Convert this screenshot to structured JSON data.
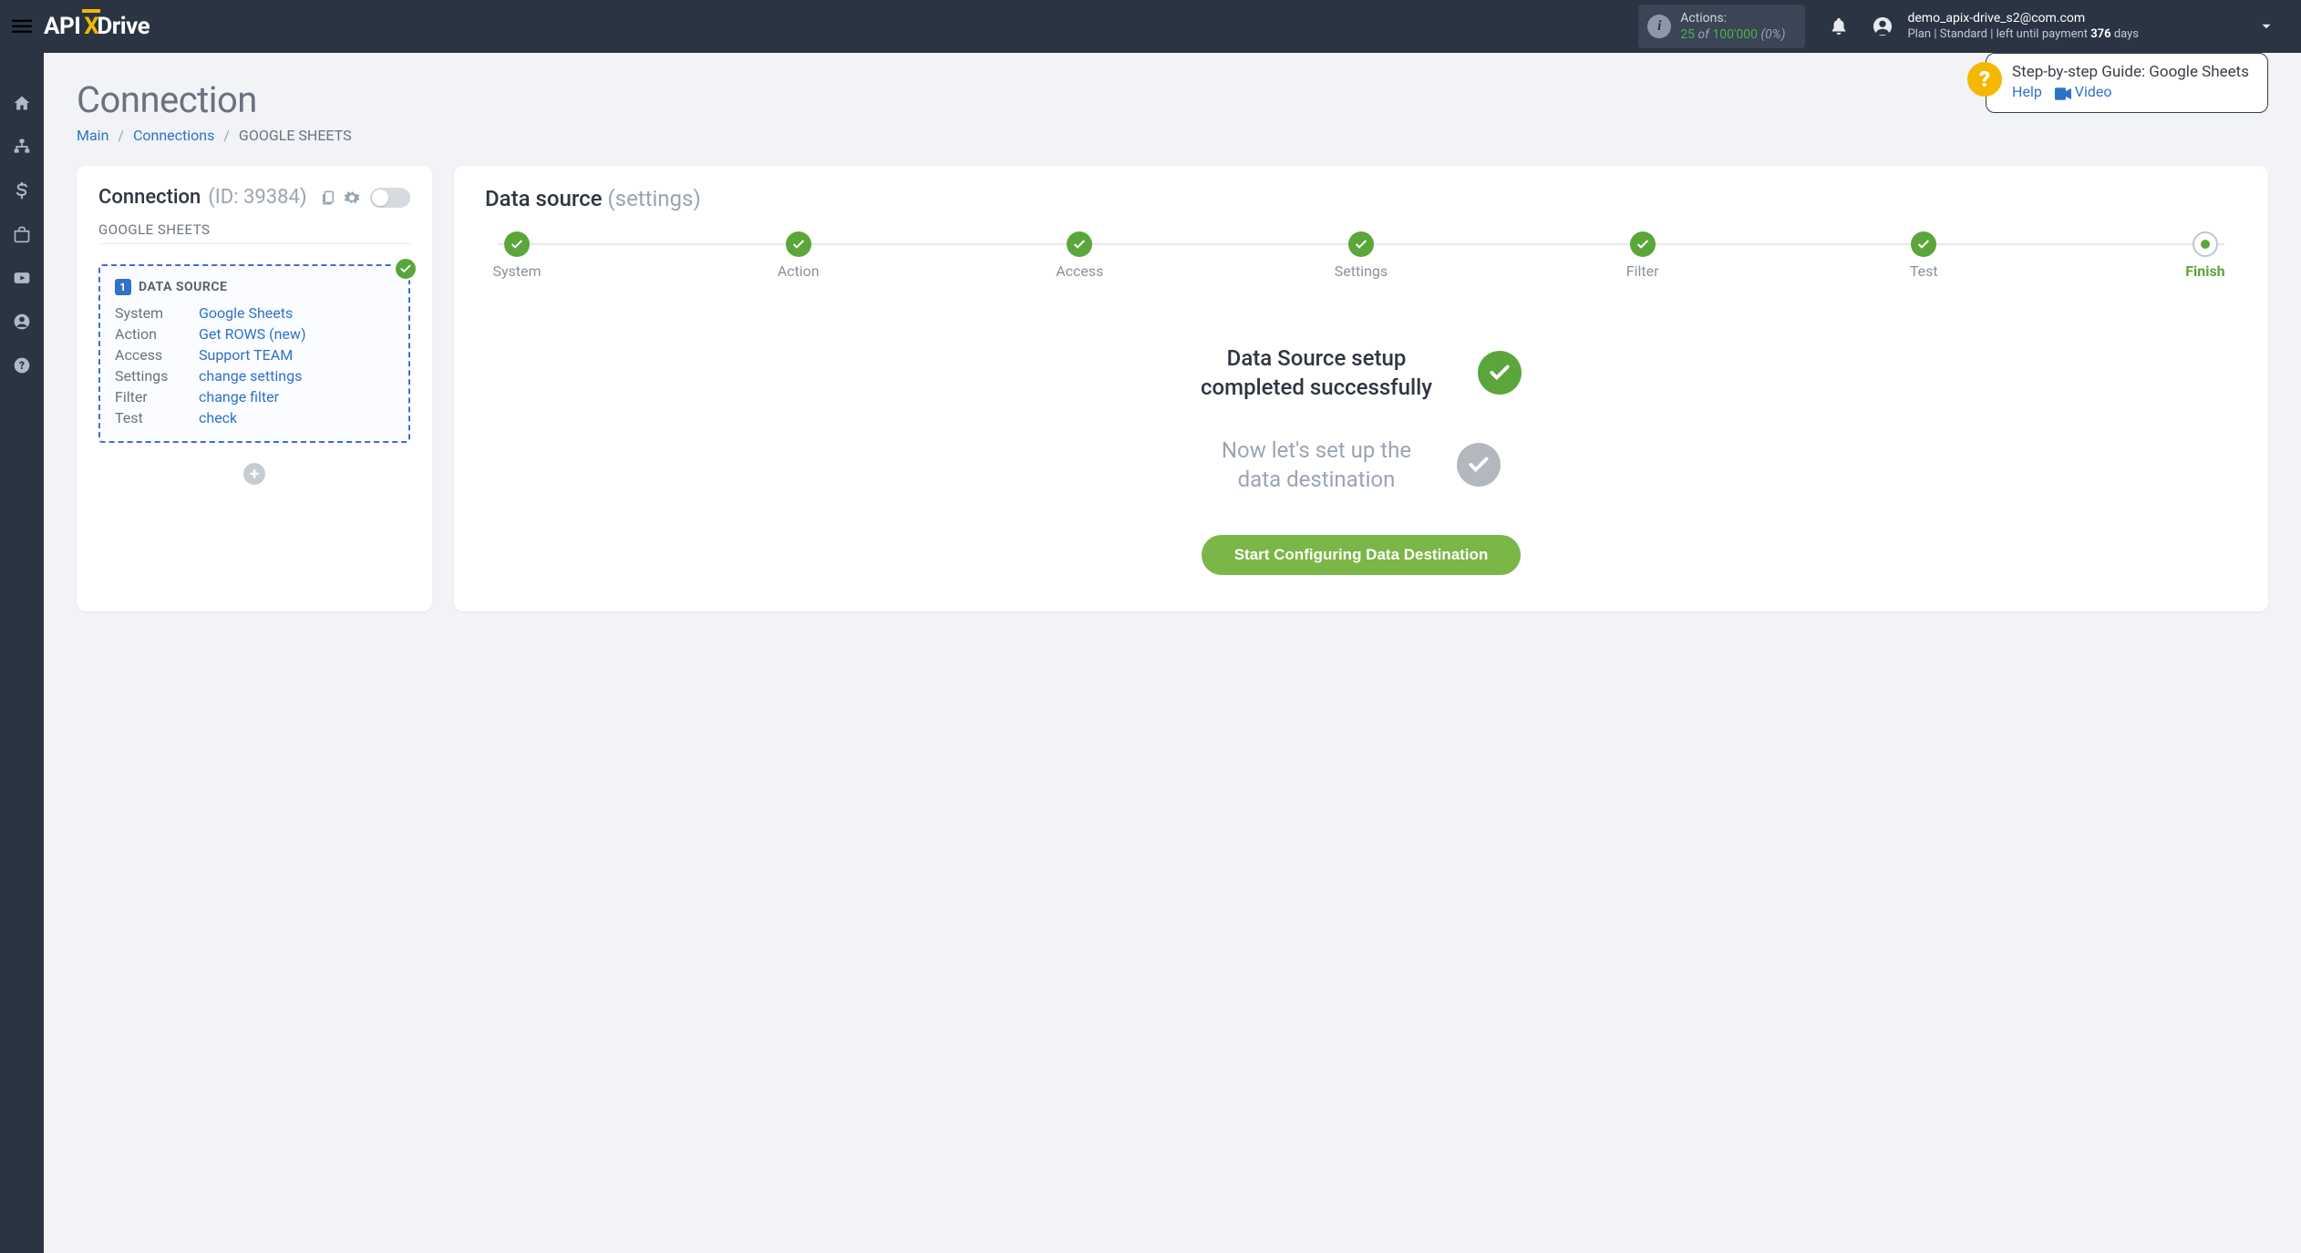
{
  "header": {
    "actions_label": "Actions:",
    "actions_count": "25",
    "actions_of": "of",
    "actions_limit": "100'000",
    "actions_pct": "(0%)",
    "user_email": "demo_apix-drive_s2@com.com",
    "plan_prefix": "Plan  |",
    "plan_name": "Standard",
    "plan_mid": "|  left until payment",
    "plan_days": "376",
    "plan_suffix": "days"
  },
  "page": {
    "title": "Connection",
    "crumb_main": "Main",
    "crumb_conn": "Connections",
    "crumb_current": "GOOGLE SHEETS"
  },
  "guide": {
    "title": "Step-by-step Guide: Google Sheets",
    "help": "Help",
    "video": "Video"
  },
  "left": {
    "title": "Connection",
    "id": "(ID: 39384)",
    "sub": "GOOGLE SHEETS",
    "ds_badge": "1",
    "ds_title": "DATA SOURCE",
    "rows": {
      "system_l": "System",
      "system_v": "Google Sheets",
      "action_l": "Action",
      "action_v": "Get ROWS (new)",
      "access_l": "Access",
      "access_v": "Support TEAM",
      "settings_l": "Settings",
      "settings_v": "change settings",
      "filter_l": "Filter",
      "filter_v": "change filter",
      "test_l": "Test",
      "test_v": "check"
    }
  },
  "right": {
    "title_strong": "Data source",
    "title_light": "(settings)",
    "steps": [
      "System",
      "Action",
      "Access",
      "Settings",
      "Filter",
      "Test",
      "Finish"
    ],
    "finish_line1": "Data Source setup",
    "finish_line2": "completed successfully",
    "next_line1": "Now let's set up the",
    "next_line2": "data destination",
    "button": "Start Configuring Data Destination"
  }
}
